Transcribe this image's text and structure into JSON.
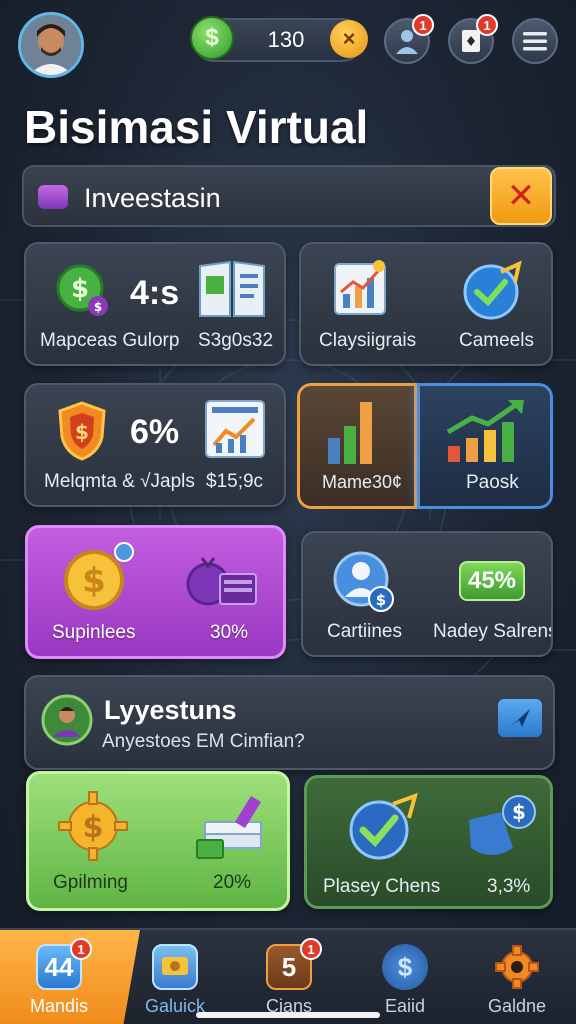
{
  "header": {
    "coins": "130",
    "coin_symbol": "$",
    "coin_add_symbol": "×",
    "profile_badge": "1",
    "cards_badge": "1"
  },
  "title": "Bisimasi Virtual",
  "invest_bar": {
    "label": "Inveestasin",
    "close_symbol": "✕"
  },
  "cards": {
    "c1": {
      "value": "4:s",
      "label_left": "Mapceas Gulorp",
      "label_right": "S3g0s32"
    },
    "c2": {
      "label_left": "Claysiigrais",
      "label_right": "Cameels"
    },
    "c3": {
      "value": "6%",
      "label_left": "Melqmta & √Japls",
      "label_right": "$15;9c"
    },
    "c4": {
      "label_left": "Mame30¢",
      "label_right": "Paosk"
    },
    "c5": {
      "label_left": "Supinlees",
      "label_right": "30%"
    },
    "c6": {
      "value": "45%",
      "label_left": "Cartiines",
      "label_right": "Nadey Salrens"
    },
    "c7": {
      "title": "Lyyestuns",
      "subtitle": "Anyestoes EM Cimfian?"
    },
    "c8": {
      "label_left": "Gpilming",
      "label_right": "20%"
    },
    "c9": {
      "label_left": "Plasey Chens",
      "label_right": "3,3%"
    }
  },
  "nav": {
    "items": [
      {
        "label": "Mandis",
        "icon_text": "44",
        "badge": "1",
        "active": true
      },
      {
        "label": "Galuick",
        "icon_text": "",
        "badge": "",
        "active": false
      },
      {
        "label": "Cians",
        "icon_text": "5",
        "badge": "1",
        "active": false
      },
      {
        "label": "Eaiid",
        "icon_text": "$",
        "badge": "",
        "active": false
      },
      {
        "label": "Galdne",
        "icon_text": "",
        "badge": "",
        "active": false
      }
    ]
  },
  "colors": {
    "accent_orange": "#f09a12",
    "coin_green": "#2f9a2a",
    "card_purple": "#9a38c2",
    "card_green": "#5fb544",
    "badge_red": "#e23a2a"
  }
}
